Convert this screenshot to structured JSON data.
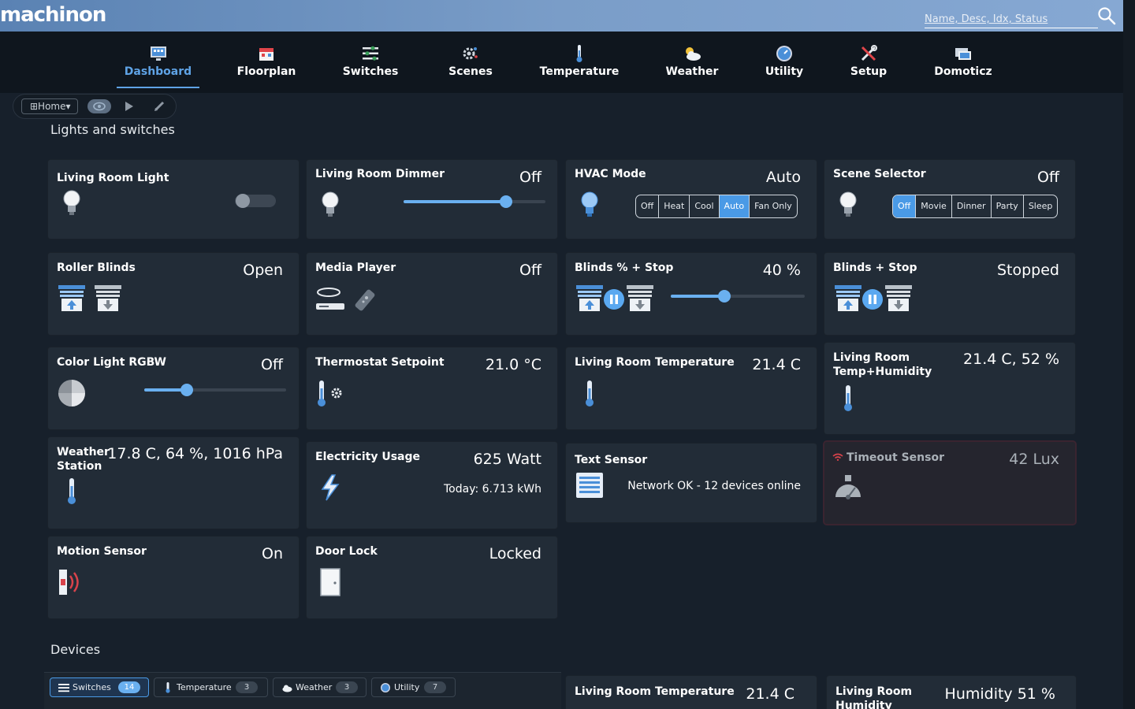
{
  "app": {
    "logo_text": "machinon",
    "search_placeholder": "Name, Desc, Idx, Status"
  },
  "nav": [
    {
      "label": "Dashboard",
      "icon": "dashboard-icon",
      "active": true
    },
    {
      "label": "Floorplan",
      "icon": "floorplan-icon"
    },
    {
      "label": "Switches",
      "icon": "switches-icon"
    },
    {
      "label": "Scenes",
      "icon": "scenes-icon"
    },
    {
      "label": "Temperature",
      "icon": "thermometer-icon"
    },
    {
      "label": "Weather",
      "icon": "weather-icon"
    },
    {
      "label": "Utility",
      "icon": "utility-icon"
    },
    {
      "label": "Setup",
      "icon": "setup-icon"
    },
    {
      "label": "Domoticz",
      "icon": "domoticz-icon"
    }
  ],
  "room_selector": {
    "label": "⊞Home▾"
  },
  "sections": {
    "lights": "Lights and switches",
    "devices": "Devices"
  },
  "cards": {
    "living_room_light": {
      "title": "Living Room Light",
      "state": "off"
    },
    "living_room_dimmer": {
      "title": "Living Room Dimmer",
      "value": "Off",
      "level": 0.72
    },
    "hvac_mode": {
      "title": "HVAC Mode",
      "value": "Auto",
      "options": [
        "Off",
        "Heat",
        "Cool",
        "Auto",
        "Fan Only"
      ],
      "selected": "Auto"
    },
    "scene_selector": {
      "title": "Scene Selector",
      "value": "Off",
      "options": [
        "Off",
        "Movie",
        "Dinner",
        "Party",
        "Sleep"
      ],
      "selected": "Off"
    },
    "roller_blinds": {
      "title": "Roller Blinds",
      "value": "Open"
    },
    "media_player": {
      "title": "Media Player",
      "value": "Off"
    },
    "blinds_percent_stop": {
      "title": "Blinds % + Stop",
      "value": "40 %",
      "level": 0.4
    },
    "blinds_stop": {
      "title": "Blinds + Stop",
      "value": "Stopped"
    },
    "color_light": {
      "title": "Color Light RGBW",
      "value": "Off",
      "level": 0.3
    },
    "thermostat": {
      "title": "Thermostat Setpoint",
      "value": "21.0 °C"
    },
    "living_room_temp": {
      "title": "Living Room Temperature",
      "value": "21.4 C"
    },
    "living_room_temp_hum": {
      "title_line1": "Living Room",
      "title_line2": "Temp+Humidity",
      "value": "21.4 C, 52 %"
    },
    "weather_station": {
      "title_line1": "Weather",
      "title_line2": "Station",
      "value": "17.8 C, 64 %, 1016 hPa"
    },
    "electricity": {
      "title": "Electricity Usage",
      "value": "625 Watt",
      "sub": "Today: 6.713 kWh"
    },
    "text_sensor": {
      "title": "Text Sensor",
      "sub": "Network OK - 12 devices online"
    },
    "timeout_sensor": {
      "title": "Timeout Sensor",
      "value": "42 Lux"
    },
    "motion_sensor": {
      "title": "Motion Sensor",
      "value": "On"
    },
    "door_lock": {
      "title": "Door Lock",
      "value": "Locked"
    }
  },
  "device_tabs": [
    {
      "label": "Switches",
      "count": "14",
      "active": true,
      "icon": "switches-icon"
    },
    {
      "label": "Temperature",
      "count": "3",
      "icon": "thermometer-icon"
    },
    {
      "label": "Weather",
      "count": "3",
      "icon": "cloud-icon"
    },
    {
      "label": "Utility",
      "count": "7",
      "icon": "utility-icon"
    }
  ],
  "device_cards": {
    "temp": {
      "title": "Living Room Temperature",
      "value": "21.4 C"
    },
    "humidity": {
      "title_line1": "Living Room",
      "title_line2": "Humidity",
      "value": "Humidity 51 %"
    }
  },
  "colors": {
    "accent": "#5fa3e6",
    "card": "#222c37",
    "background": "#17202b"
  }
}
